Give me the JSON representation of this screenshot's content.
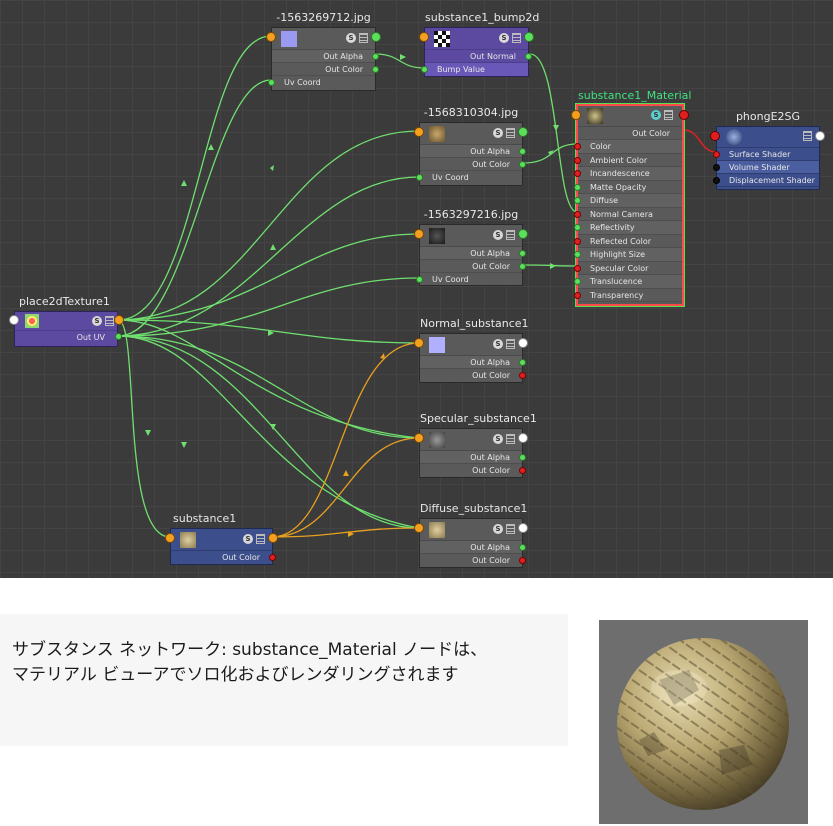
{
  "nodes": {
    "place2d": {
      "title": "place2dTexture1",
      "out_uv": "Out UV"
    },
    "tex1": {
      "title": "-1563269712.jpg",
      "out_alpha": "Out Alpha",
      "out_color": "Out Color",
      "uv_coord": "Uv Coord"
    },
    "bump": {
      "title": "substance1_bump2d",
      "out_normal": "Out Normal",
      "bump_value": "Bump Value"
    },
    "tex2": {
      "title": "-1568310304.jpg",
      "out_alpha": "Out Alpha",
      "out_color": "Out Color",
      "uv_coord": "Uv Coord"
    },
    "tex3": {
      "title": "-1563297216.jpg",
      "out_alpha": "Out Alpha",
      "out_color": "Out Color",
      "uv_coord": "Uv Coord"
    },
    "material": {
      "title": "substance1_Material",
      "out_color": "Out Color",
      "attrs": [
        "Color",
        "Ambient Color",
        "Incandescence",
        "Matte Opacity",
        "Diffuse",
        "Normal Camera",
        "Reflectivity",
        "Reflected Color",
        "Highlight Size",
        "Specular Color",
        "Translucence",
        "Transparency"
      ]
    },
    "sg": {
      "title": "phongE2SG",
      "attrs": [
        "Surface Shader",
        "Volume Shader",
        "Displacement Shader"
      ]
    },
    "normal": {
      "title": "Normal_substance1",
      "out_alpha": "Out Alpha",
      "out_color": "Out Color"
    },
    "specular": {
      "title": "Specular_substance1",
      "out_alpha": "Out Alpha",
      "out_color": "Out Color"
    },
    "diffuse": {
      "title": "Diffuse_substance1",
      "out_alpha": "Out Alpha",
      "out_color": "Out Color"
    },
    "substance": {
      "title": "substance1",
      "out_color": "Out Color"
    }
  },
  "caption": {
    "line1": "サブスタンス ネットワーク: substance_Material ノードは、",
    "line2": "マテリアル ビューアでソロ化およびレンダリングされます"
  },
  "colors": {
    "wire_green": "#6fe06f",
    "wire_orange": "#e8a020",
    "wire_red": "#e02020",
    "graph_bg": "#3b3b3b",
    "material_title": "#40e080"
  }
}
